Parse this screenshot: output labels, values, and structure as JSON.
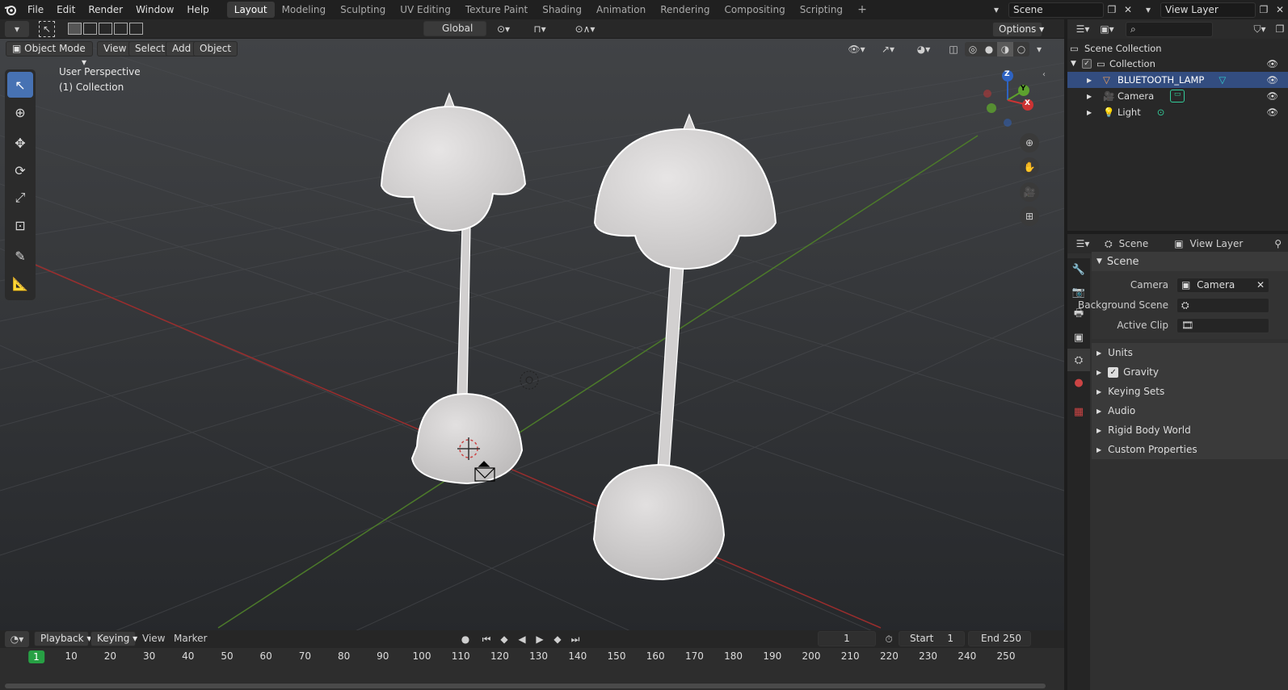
{
  "menu": {
    "items": [
      "File",
      "Edit",
      "Render",
      "Window",
      "Help"
    ]
  },
  "workspaces": {
    "tabs": [
      "Layout",
      "Modeling",
      "Sculpting",
      "UV Editing",
      "Texture Paint",
      "Shading",
      "Animation",
      "Rendering",
      "Compositing",
      "Scripting"
    ],
    "active": "Layout",
    "add_label": "+"
  },
  "scene_selector": {
    "value": "Scene"
  },
  "view_layer_selector": {
    "value": "View Layer"
  },
  "viewport_header": {
    "orientation": "Global",
    "options_label": "Options",
    "mode": "Object Mode",
    "menus": [
      "View",
      "Select",
      "Add",
      "Object"
    ]
  },
  "viewport": {
    "view_name": "User Perspective",
    "collection_label": "(1) Collection"
  },
  "gizmo": {
    "z": "Z",
    "y": "Y",
    "x": "X"
  },
  "outliner": {
    "root": "Scene Collection",
    "collection": "Collection",
    "objects": [
      {
        "name": "BLUETOOTH_LAMP",
        "selected": true
      },
      {
        "name": "Camera",
        "selected": false
      },
      {
        "name": "Light",
        "selected": false
      }
    ]
  },
  "properties": {
    "header_scene": "Scene",
    "header_view_layer": "View Layer",
    "panel_title": "Scene",
    "fields": {
      "camera_label": "Camera",
      "camera_value": "Camera",
      "background_scene_label": "Background Scene",
      "active_clip_label": "Active Clip"
    },
    "subpanels": [
      "Units",
      "Gravity",
      "Keying Sets",
      "Audio",
      "Rigid Body World",
      "Custom Properties"
    ],
    "gravity_checked": true
  },
  "timeline": {
    "menus": [
      "Playback",
      "Keying",
      "View",
      "Marker"
    ],
    "current_frame": "1",
    "start_label": "Start",
    "start_value": "1",
    "end_label": "End",
    "end_value": "250",
    "ticks": [
      "1",
      "10",
      "20",
      "30",
      "40",
      "50",
      "60",
      "70",
      "80",
      "90",
      "100",
      "110",
      "120",
      "130",
      "140",
      "150",
      "160",
      "170",
      "180",
      "190",
      "200",
      "210",
      "220",
      "230",
      "240",
      "250"
    ]
  },
  "colors": {
    "accent": "#4772b3",
    "frame_marker": "#27a044",
    "x_axis": "#9a2d2d",
    "y_axis": "#4c7a2a"
  }
}
